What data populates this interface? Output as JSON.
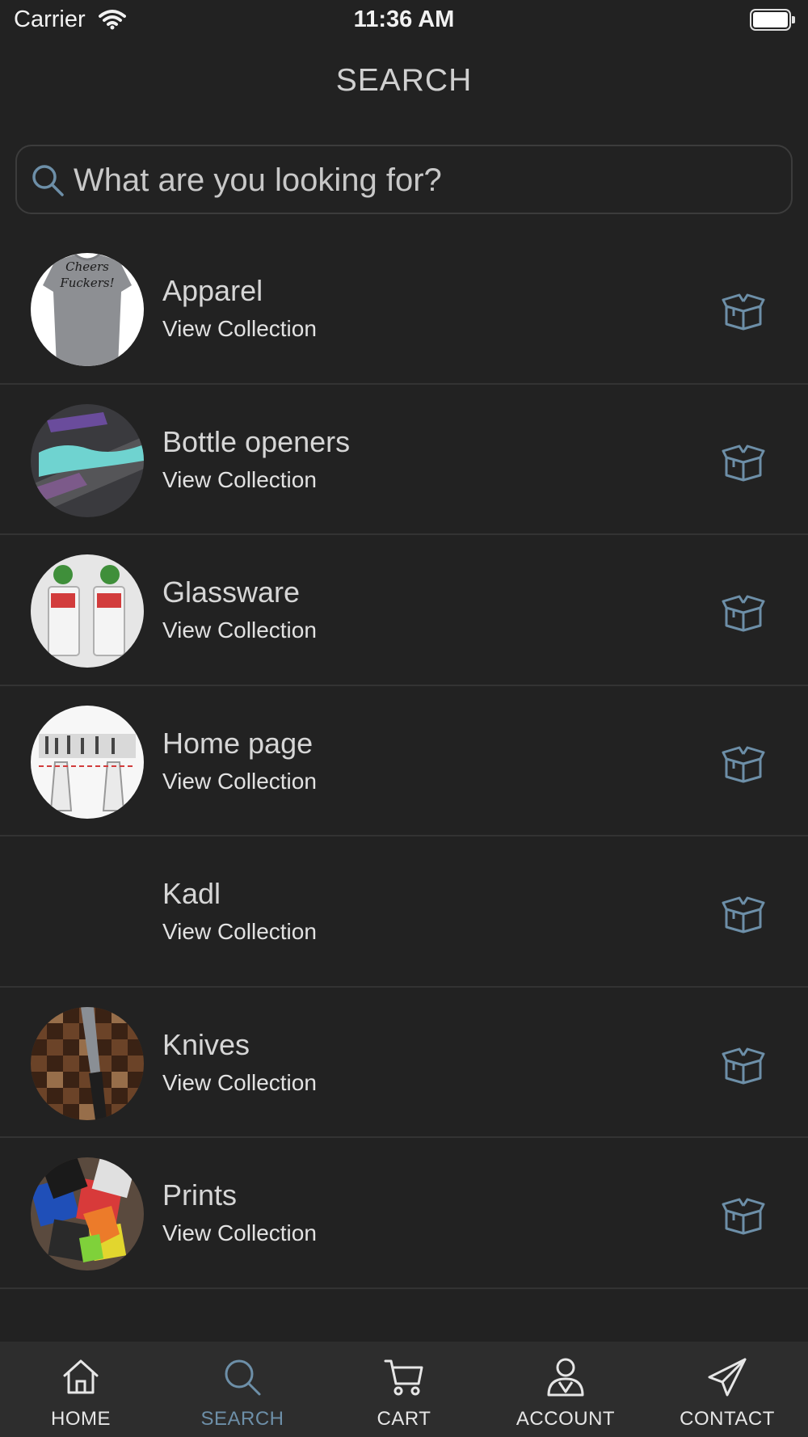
{
  "status_bar": {
    "carrier": "Carrier",
    "time": "11:36 AM"
  },
  "header": {
    "title": "SEARCH"
  },
  "search": {
    "placeholder": "What are you looking for?",
    "value": ""
  },
  "collections": [
    {
      "title": "Apparel",
      "subtitle": "View Collection",
      "thumb_text": "Cheers Fuckers!"
    },
    {
      "title": "Bottle openers",
      "subtitle": "View Collection"
    },
    {
      "title": "Glassware",
      "subtitle": "View Collection"
    },
    {
      "title": "Home page",
      "subtitle": "View Collection"
    },
    {
      "title": "Kadl",
      "subtitle": "View Collection"
    },
    {
      "title": "Knives",
      "subtitle": "View Collection"
    },
    {
      "title": "Prints",
      "subtitle": "View Collection"
    }
  ],
  "tabs": [
    {
      "label": "HOME",
      "icon": "home-icon"
    },
    {
      "label": "SEARCH",
      "icon": "search-icon",
      "active": true
    },
    {
      "label": "CART",
      "icon": "cart-icon"
    },
    {
      "label": "ACCOUNT",
      "icon": "account-icon"
    },
    {
      "label": "CONTACT",
      "icon": "paper-plane-icon"
    }
  ],
  "colors": {
    "background": "#222222",
    "accent": "#6d8fa8",
    "tab_bar": "#2d2d2d",
    "divider": "#333333"
  }
}
